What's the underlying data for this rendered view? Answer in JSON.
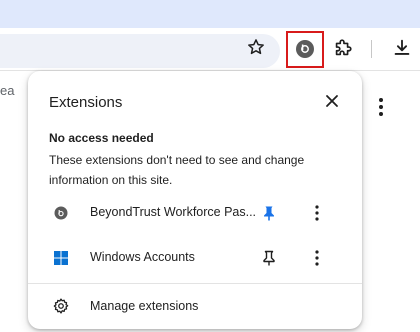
{
  "toolbar": {
    "icons": [
      "star-icon",
      "beyondtrust-extension-icon",
      "puzzle-piece-icon",
      "download-icon"
    ],
    "highlight_color": "#d81b1b"
  },
  "page": {
    "partial_text": "ea"
  },
  "popup": {
    "title": "Extensions",
    "close_icon": "close-icon",
    "section_title": "No access needed",
    "section_description": "These extensions don't need to see and change information on this site.",
    "extensions": [
      {
        "name": "BeyondTrust Workforce Pas...",
        "icon": "beyondtrust-icon",
        "pinned": true
      },
      {
        "name": "Windows Accounts",
        "icon": "windows-icon",
        "pinned": false
      }
    ],
    "manage_label": "Manage extensions",
    "manage_icon": "gear-icon"
  },
  "colors": {
    "tab_strip": "#dfe8fc",
    "pin_active": "#1a73e8",
    "windows_blue": "#0a72d1"
  }
}
